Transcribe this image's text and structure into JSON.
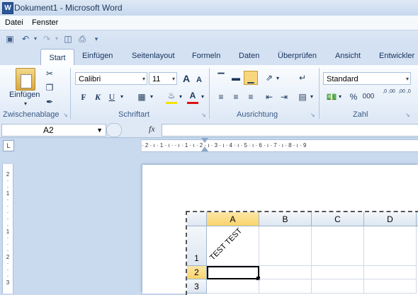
{
  "window": {
    "title": "Dokument1 - Microsoft Word",
    "app_icon": "W"
  },
  "menu": [
    "Datei",
    "Fenster"
  ],
  "tabs": [
    "Start",
    "Einfügen",
    "Seitenlayout",
    "Formeln",
    "Daten",
    "Überprüfen",
    "Ansicht",
    "Entwickler"
  ],
  "ribbon": {
    "clipboard": {
      "paste_label": "Einfügen",
      "group_label": "Zwischenablage"
    },
    "font": {
      "name": "Calibri",
      "size": "11",
      "group_label": "Schriftart",
      "bold": "F",
      "italic": "K",
      "underline": "U",
      "grow": "A",
      "shrink": "A",
      "font_color": "A",
      "font_color_hex": "#e01010",
      "highlight_hex": "#f5e400"
    },
    "alignment": {
      "group_label": "Ausrichtung"
    },
    "number": {
      "format": "Standard",
      "group_label": "Zahl",
      "percent": "%",
      "thousands": "000",
      "inc_decimal": ",0 ,00",
      "dec_decimal": ",00 ,0"
    }
  },
  "formula_bar": {
    "name_box": "A2",
    "fx": "fx",
    "value": ""
  },
  "ruler": {
    "corner": "L",
    "ticks": "· 2 · ı · 1 · ı ·   · ı · 1 · ı · 2 · ı · 3 · ı · 4 · ı · 5 · ı · 6 · ı · 7 · ı · 8 · ı · 9"
  },
  "sheet": {
    "columns": [
      "A",
      "B",
      "C",
      "D"
    ],
    "rows": [
      "1",
      "2",
      "3"
    ],
    "selected_column": "A",
    "selected_row": "2",
    "active_cell": "A2",
    "cell_a1": "TEST TEST"
  }
}
